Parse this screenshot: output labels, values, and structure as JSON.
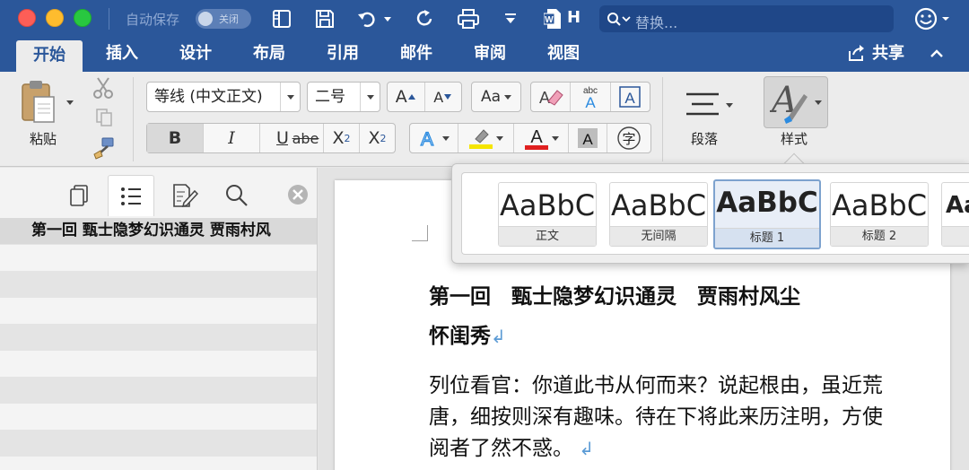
{
  "titlebar": {
    "autosave_label": "自动保存",
    "autosave_state": "关闭",
    "doc_letter": "H",
    "search_placeholder": "替换..."
  },
  "tabs": [
    {
      "label": "开始",
      "active": true
    },
    {
      "label": "插入"
    },
    {
      "label": "设计"
    },
    {
      "label": "布局"
    },
    {
      "label": "引用"
    },
    {
      "label": "邮件"
    },
    {
      "label": "审阅"
    },
    {
      "label": "视图"
    }
  ],
  "share_label": "共享",
  "ribbon": {
    "paste_label": "粘贴",
    "font_name": "等线 (中文正文)",
    "font_size": "二号",
    "bold": "B",
    "italic": "I",
    "underline": "U",
    "strike": "abe",
    "subscript": "X",
    "subscript_mark": "2",
    "superscript": "X",
    "superscript_mark": "2",
    "grow_font": "A",
    "shrink_font": "A",
    "change_case": "Aa",
    "abc": "abc",
    "clear_format_letter": "A",
    "font_color_letter": "A",
    "shading_letter": "A",
    "enclose_char": "字",
    "paragraph_label": "段落",
    "styles_label": "样式",
    "font_color_hex": "#e02020",
    "highlight_hex": "#f5e500"
  },
  "nav": {
    "heading": "第一回  甄士隐梦幻识通灵 贾雨村风"
  },
  "document": {
    "heading_line1": "第一回　甄士隐梦幻识通灵　贾雨村风尘",
    "heading_line2": "怀闺秀",
    "paragraph": "列位看官：你道此书从何而来？说起根由，虽近荒唐，细按则深有趣味。待在下将此来历注明，方使阅者了然不惑。"
  },
  "styles_gallery": [
    {
      "sample": "AaBbC",
      "name": "正文"
    },
    {
      "sample": "AaBbC",
      "name": "无间隔"
    },
    {
      "sample": "AaBbC",
      "name": "标题 1",
      "selected": true
    },
    {
      "sample": "AaBbC",
      "name": "标题 2"
    },
    {
      "sample": "Aa",
      "name": ""
    }
  ],
  "colors": {
    "brand": "#2b579a",
    "ribbon_bg": "#ececec",
    "pilcrow": "#5b9bd5"
  }
}
